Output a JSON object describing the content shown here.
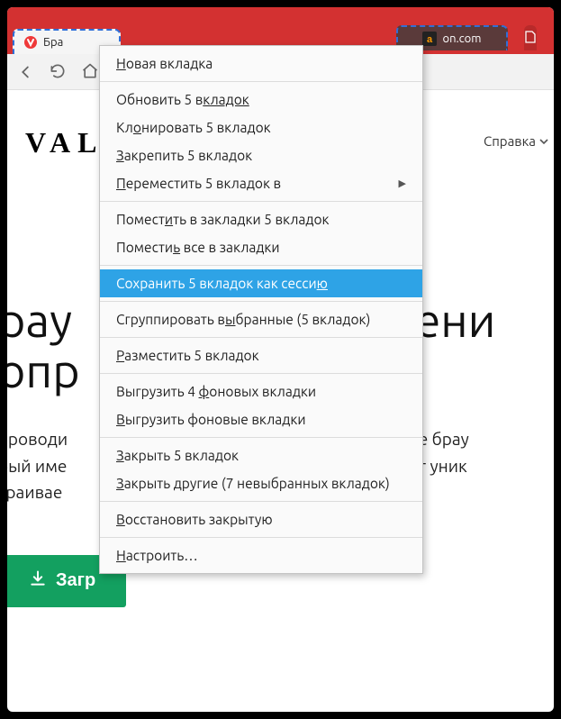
{
  "tabs": {
    "t1_label": "Бра",
    "t3_suffix": "on.com"
  },
  "page": {
    "brand": "VALD",
    "help": "Справка",
    "hero_line1_a": "рау",
    "hero_line1_b": "нени",
    "hero_line2": "опр",
    "para_left1": "проводи",
    "para_right1": "йте брау",
    "para_left2": "рый име",
    "para_right2": "ает уник",
    "para_left3": "траивае",
    "download": "Загр"
  },
  "menu": {
    "new_tab": "овая вкладка",
    "reload": "Обновить 5 в",
    "reload_suf": "кладок",
    "clone": "Кл",
    "clone_suf": "онировать 5 вкладок",
    "pin": "З",
    "pin_suf": "акрепить 5 вкладок",
    "move": "П",
    "move_suf": "ереместить 5 вкладок в",
    "bookmark_sel": "Помест",
    "bookmark_sel_suf": "ть в закладки 5 вкладок",
    "bookmark_all": "Помести",
    "bookmark_all_suf": " все в закладки",
    "save_session": "Сохранить 5 вкладок как сесси",
    "save_session_suf": "ю",
    "stack": "Сгруппировать в",
    "stack_suf": "бранные (5 вкладок)",
    "tile": "Р",
    "tile_suf": "азместить 5 вкладок",
    "hibernate_bg": "Выгрузить 4 ",
    "hibernate_bg_suf": "фоновых вкладки",
    "hibernate_bg2": "В",
    "hibernate_bg2_suf": "ыгрузить фоновые вкладки",
    "close_sel": "З",
    "close_sel_suf": "акрыть 5 вкладок",
    "close_other": "З",
    "close_other_suf": "акрыть другие (7 невыбранных вкладок)",
    "reopen": "В",
    "reopen_suf": "осстановить закрытую",
    "customize": "Н",
    "customize_suf": "астроить…"
  }
}
